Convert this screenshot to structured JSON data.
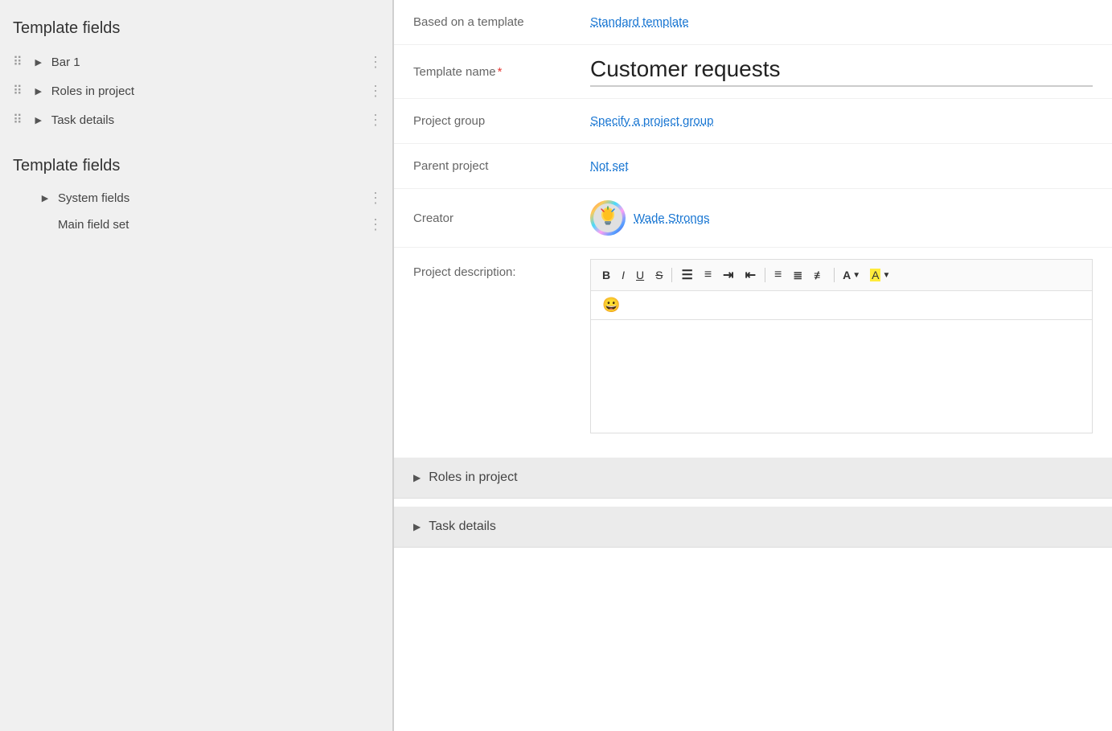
{
  "left_panel": {
    "section1_title": "Template fields",
    "section1_items": [
      {
        "id": "bar1",
        "label": "Bar 1"
      },
      {
        "id": "roles",
        "label": "Roles in project"
      },
      {
        "id": "task",
        "label": "Task details"
      }
    ],
    "section2_title": "Template fields",
    "section2_items": [
      {
        "id": "system",
        "label": "System fields",
        "indented": true
      },
      {
        "id": "mainfieldset",
        "label": "Main field set",
        "indented": true
      }
    ]
  },
  "right_panel": {
    "based_on_label": "Based on a template",
    "based_on_value": "Standard template",
    "template_name_label": "Template name",
    "template_name_required": "*",
    "template_name_value": "Customer requests",
    "project_group_label": "Project group",
    "project_group_value": "Specify a project group",
    "parent_project_label": "Parent project",
    "parent_project_value": "Not set",
    "creator_label": "Creator",
    "creator_name": "Wade Strongs",
    "creator_avatar_emoji": "💡",
    "description_label": "Project description:",
    "toolbar": {
      "bold": "B",
      "italic": "I",
      "underline": "U",
      "strikethrough": "S",
      "ordered_list": "ol",
      "unordered_list": "ul",
      "indent_more": "+→",
      "indent_less": "←",
      "align_left": "≡",
      "align_center": "⊜",
      "align_right": "⊟",
      "font_color": "A",
      "highlight": "A",
      "emoji": "😀"
    },
    "collapse_sections": [
      {
        "id": "roles_section",
        "label": "Roles in project"
      },
      {
        "id": "task_section",
        "label": "Task details"
      }
    ]
  }
}
